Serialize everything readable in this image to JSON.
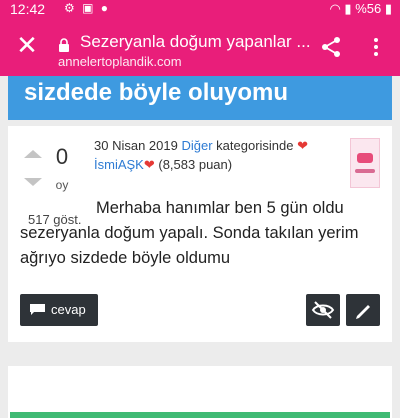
{
  "status_bar": {
    "time": "12:42",
    "battery": "%56"
  },
  "browser": {
    "page_title": "Sezeryanla doğum yapanlar ...",
    "url": "annelertoplandik.com"
  },
  "banner": {
    "text": "sizdede böyle oluyomu"
  },
  "question": {
    "vote_count": "0",
    "vote_label": "oy",
    "views": "517 göst.",
    "date": "30 Nisan 2019",
    "category": "Diğer",
    "category_suffix": "kategorisinde",
    "author": "İsmiAŞK",
    "points": "(8,583 puan)",
    "body": "Merhaba hanımlar ben 5 gün oldu sezeryanla doğum yapalı. Sonda takılan yerim ağrıyo sizdede böyle oldumu"
  },
  "actions": {
    "answer_label": "cevap"
  },
  "colors": {
    "accent": "#e91e7a",
    "banner": "#3e9ae0",
    "link": "#2e7bd3",
    "button": "#2e3338"
  }
}
